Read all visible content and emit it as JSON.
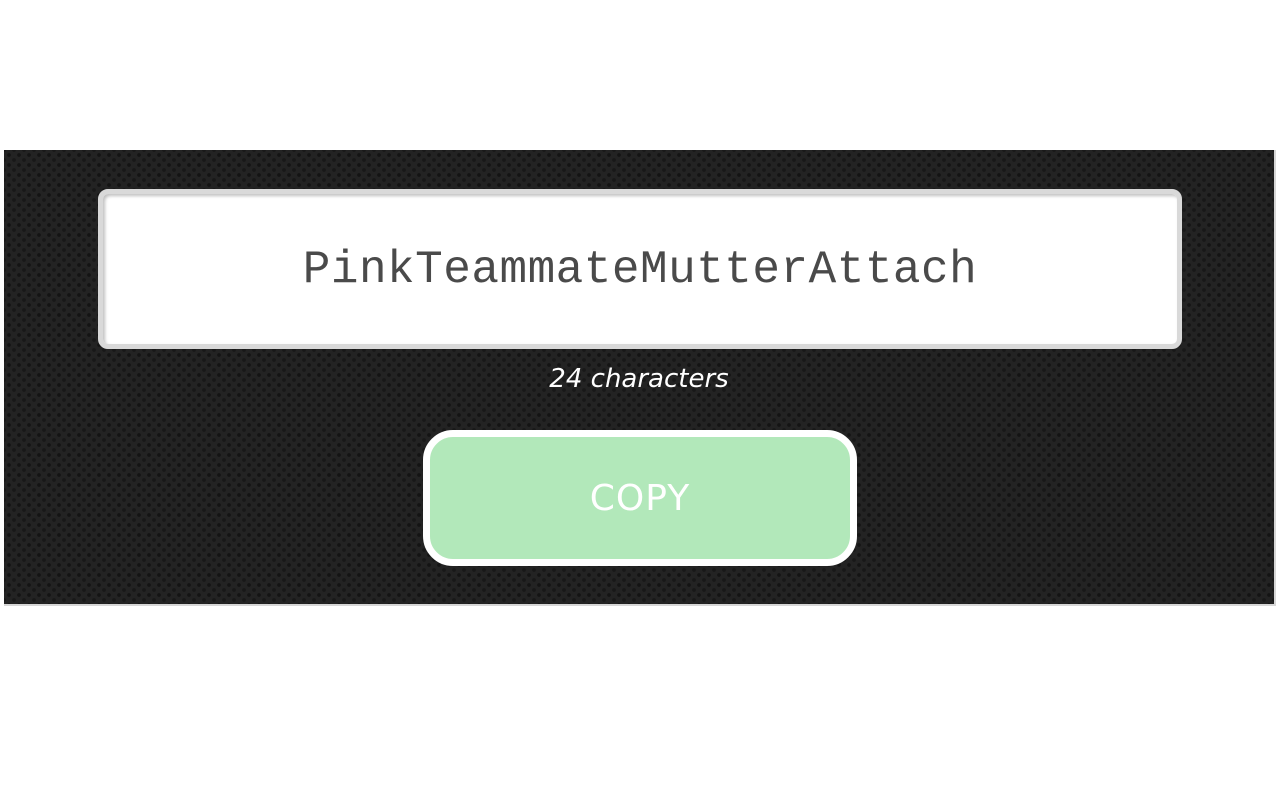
{
  "password": {
    "value": "PinkTeammateMutterAttach"
  },
  "length_info": {
    "label": "24 characters"
  },
  "copy_button": {
    "label": "COPY",
    "color": "#b2e8ba"
  },
  "theme": {
    "panel_background": "#232323",
    "text_color": "#ffffff"
  }
}
